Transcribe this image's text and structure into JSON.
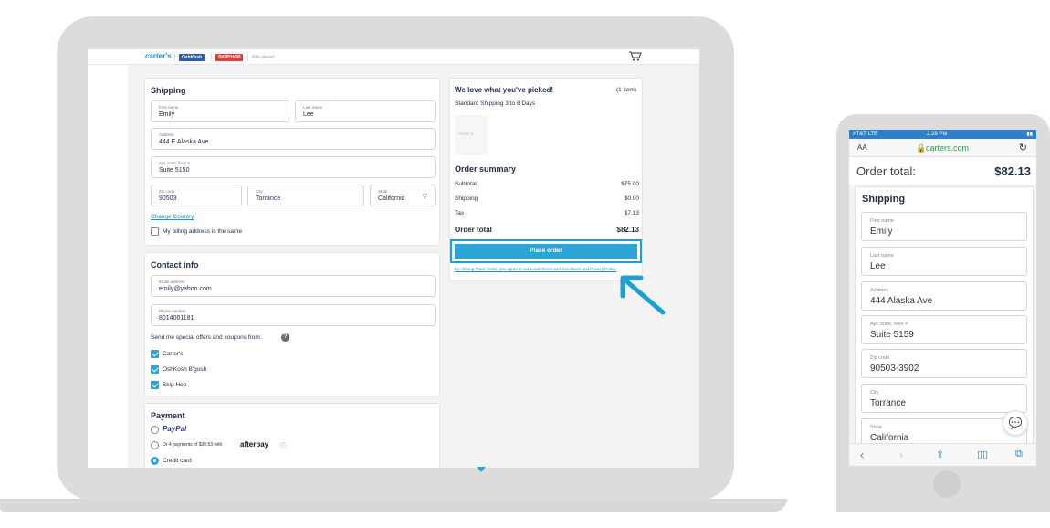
{
  "laptop": {
    "brands": {
      "carters": "carter's",
      "oshkosh": "OshKosh",
      "skiphop": "SKIP*HOP",
      "littleplanet": "little planet"
    },
    "cart_icon": "cart-icon",
    "shipping": {
      "title": "Shipping",
      "first_name_label": "First name",
      "first_name": "Emily",
      "last_name_label": "Last name",
      "last_name": "Lee",
      "address_label": "Address",
      "address": "444 E Alaska Ave",
      "apt_label": "Apt, suite, floor #",
      "apt": "Suite 5150",
      "zip_label": "Zip code",
      "zip": "90503",
      "city_label": "City",
      "city": "Torrance",
      "state_label": "State",
      "state": "California",
      "change_country": "Change Country",
      "billing_same": "My billing address is the same"
    },
    "contact": {
      "title": "Contact info",
      "email_label": "Email address",
      "email": "emily@yahoo.com",
      "phone_label": "Phone number",
      "phone": "8014001181",
      "offers_text": "Send me special offers and coupons from:",
      "brands": [
        "Carter's",
        "OshKosh B'gosh",
        "Skip Hop"
      ]
    },
    "payment": {
      "title": "Payment",
      "paypal": "PayPal",
      "afterpay_text": "Or 4 payments of $20.53 with",
      "afterpay_brand": "afterpay",
      "credit_card": "Credit card"
    },
    "summary": {
      "picked_title": "We love what you've picked!",
      "item_count": "(1 item)",
      "shipping_note": "Standard Shipping 3 to 8 Days",
      "thumb_brand": "carter's",
      "title": "Order summary",
      "subtotal_label": "Subtotal",
      "subtotal": "$75.00",
      "shipping_label": "Shipping",
      "shipping": "$0.00",
      "tax_label": "Tax",
      "tax": "$7.13",
      "total_label": "Order total",
      "total": "$82.13",
      "place_order": "Place order",
      "terms": "By clicking Place Order, you agree to our Local Terms and Conditions and Privacy Policy."
    }
  },
  "phone": {
    "status_left": "AT&T LTE",
    "status_time": "2:28 PM",
    "text_size": "AA",
    "url": "carters.com",
    "order_total_label": "Order total:",
    "order_total": "$82.13",
    "shipping_title": "Shipping",
    "fields": [
      {
        "label": "First name",
        "value": "Emily"
      },
      {
        "label": "Last name",
        "value": "Lee"
      },
      {
        "label": "Address",
        "value": "444 Alaska Ave"
      },
      {
        "label": "Apt, suite, floor #",
        "value": "Suite 5159"
      },
      {
        "label": "Zip code",
        "value": "90503-3902"
      },
      {
        "label": "City",
        "value": "Torrance"
      },
      {
        "label": "State",
        "value": "California"
      }
    ]
  },
  "colors": {
    "accent": "#2aa6d6",
    "highlight": "#1aa0d2",
    "text": "#1f2a44"
  }
}
